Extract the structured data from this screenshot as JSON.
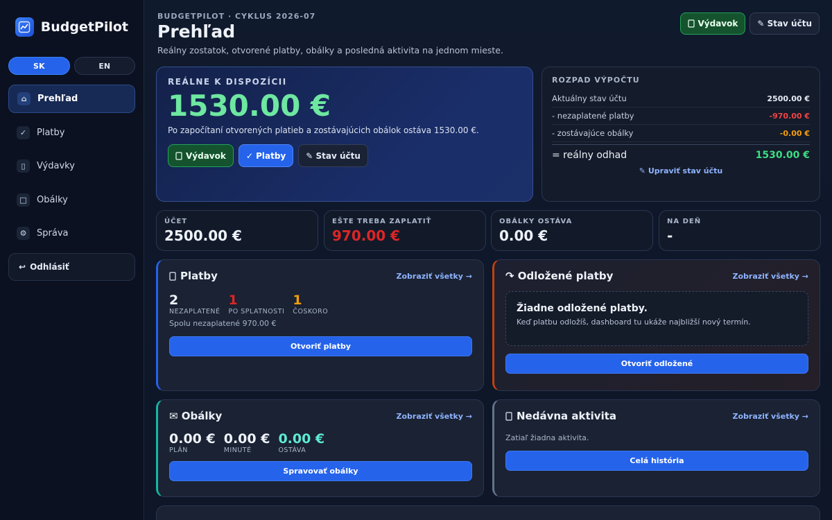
{
  "brand": {
    "name": "BudgetPilot"
  },
  "lang": {
    "sk": "SK",
    "en": "EN"
  },
  "nav": [
    {
      "icon": "⌂",
      "label": "Prehľad"
    },
    {
      "icon": "✓",
      "label": "Platby"
    },
    {
      "icon": "▯",
      "label": "Výdavky"
    },
    {
      "icon": "□",
      "label": "Obálky"
    },
    {
      "icon": "⚙",
      "label": "Správa"
    }
  ],
  "logout": {
    "icon": "↩",
    "label": "Odhlásiť"
  },
  "header": {
    "eyebrow": "BUDGETPILOT · CYKLUS 2026-07",
    "title": "Prehľad",
    "subtitle": "Reálny zostatok, otvorené platby, obálky a posledná aktivita na jednom mieste.",
    "expense_btn": "Výdavok",
    "balance_btn": "✎ Stav účtu"
  },
  "hero": {
    "label": "REÁLNE K DISPOZÍCII",
    "value": "1530.00 €",
    "desc": "Po započítaní otvorených platieb a zostávajúcich obálok ostáva 1530.00 €.",
    "btn_expense": "Výdavok",
    "btn_payments": "✓ Platby",
    "btn_balance": "✎ Stav účtu"
  },
  "breakdown": {
    "title": "ROZPAD VÝPOČTU",
    "rows": [
      {
        "label": "Aktuálny stav účtu",
        "value": "2500.00 €",
        "color": "#e6ebf5"
      },
      {
        "label": "- nezaplatené platby",
        "value": "-970.00 €",
        "color": "#ef4444"
      },
      {
        "label": "- zostávajúce obálky",
        "value": "-0.00 €",
        "color": "#f59e0b"
      }
    ],
    "total_label": "= reálny odhad",
    "total_value": "1530.00 €",
    "edit_link": "✎ Upraviť stav účtu"
  },
  "stats": [
    {
      "label": "ÚČET",
      "value": "2500.00 €",
      "color": "#eef2f8"
    },
    {
      "label": "EŠTE TREBA ZAPLATIŤ",
      "value": "970.00 €",
      "color": "#dc2626"
    },
    {
      "label": "OBÁLKY OSTÁVA",
      "value": "0.00 €",
      "color": "#eef2f8"
    },
    {
      "label": "NA DEŇ",
      "value": "-",
      "color": "#eef2f8"
    }
  ],
  "payments": {
    "title": "Platby",
    "link": "Zobraziť všetky →",
    "counts": [
      {
        "num": "2",
        "label": "NEZAPLATENÉ",
        "color": "#eef2f8"
      },
      {
        "num": "1",
        "label": "PO SPLATNOSTI",
        "color": "#dc2626"
      },
      {
        "num": "1",
        "label": "ČOSKORO",
        "color": "#f59e0b"
      }
    ],
    "note": "Spolu nezaplatené 970.00 €",
    "button": "Otvoriť platby"
  },
  "postponed": {
    "title": "↷ Odložené platby",
    "link": "Zobraziť všetky →",
    "empty_title": "Žiadne odložené platby.",
    "empty_sub": "Keď platbu odložíš, dashboard tu ukáže najbližší nový termín.",
    "button": "Otvoriť odložené"
  },
  "envelopes": {
    "title": "✉ Obálky",
    "link": "Zobraziť všetky →",
    "counts": [
      {
        "num": "0.00 €",
        "label": "PLÁN",
        "color": "#eef2f8"
      },
      {
        "num": "0.00 €",
        "label": "MINUTÉ",
        "color": "#eef2f8"
      },
      {
        "num": "0.00 €",
        "label": "OSTÁVA",
        "color": "#5eead4"
      }
    ],
    "button": "Spravovať obálky"
  },
  "activity": {
    "title": "Nedávna aktivita",
    "link": "Zobraziť všetky →",
    "empty": "Zatiaľ žiadna aktivita.",
    "button": "Celá história"
  },
  "colors": {
    "accent": "#2563eb",
    "positive": "#3ddc84",
    "negative": "#ef4444",
    "warning": "#f59e0b"
  }
}
